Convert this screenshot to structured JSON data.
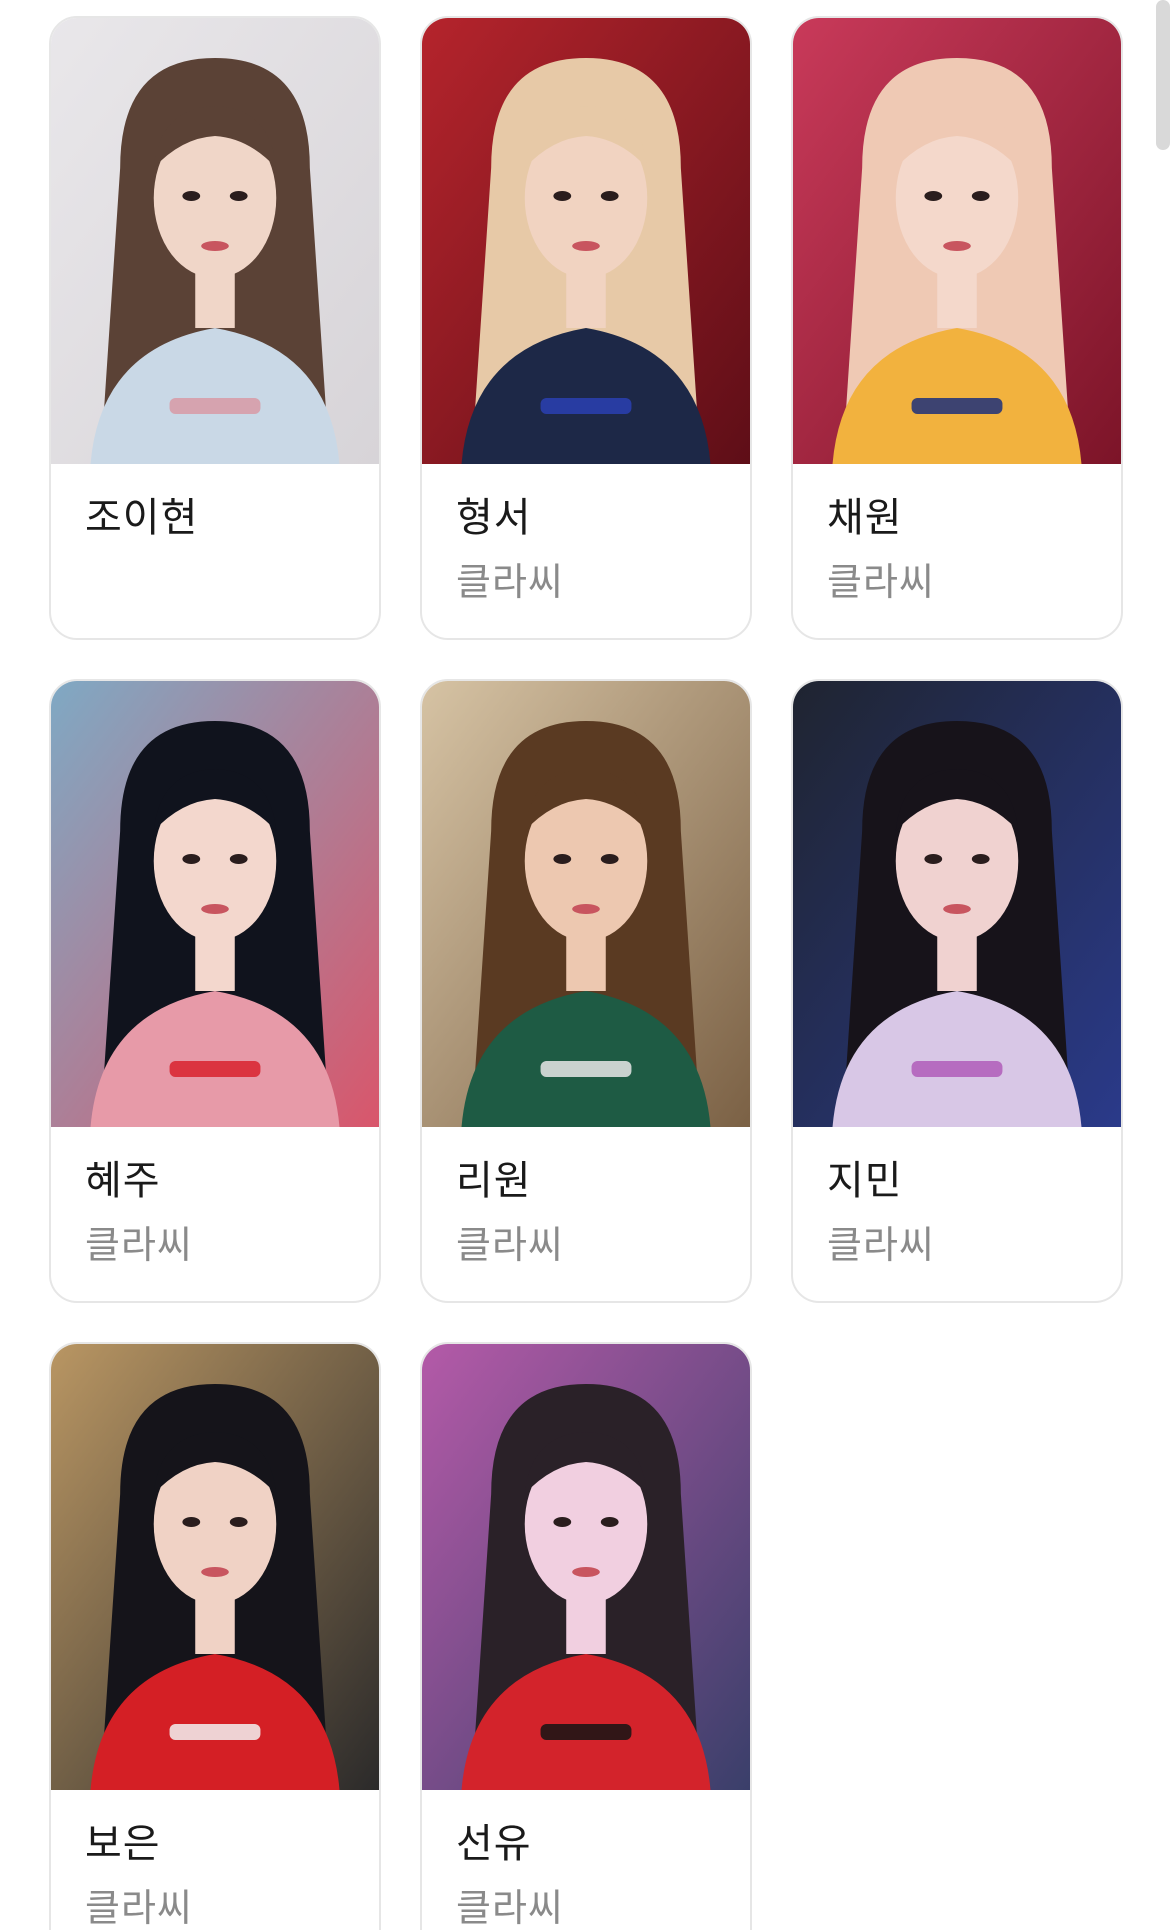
{
  "members": [
    {
      "name": "조이현",
      "group": "",
      "palette": {
        "bg1": "#e9e7ea",
        "bg2": "#d7d4d8",
        "hair": "#5b4236",
        "skin": "#f0d6c8",
        "top": "#c9d8e6",
        "accent": "#d89aa5"
      }
    },
    {
      "name": "형서",
      "group": "클라씨",
      "palette": {
        "bg1": "#b5242c",
        "bg2": "#5e0e17",
        "hair": "#e7c9a7",
        "skin": "#f1d3c1",
        "top": "#1d2847",
        "accent": "#2a3fb3"
      }
    },
    {
      "name": "채원",
      "group": "클라씨",
      "palette": {
        "bg1": "#c93a5a",
        "bg2": "#7c1428",
        "hair": "#efc9b4",
        "skin": "#f4d8cb",
        "top": "#f2b23e",
        "accent": "#1d2f7a"
      }
    },
    {
      "name": "혜주",
      "group": "클라씨",
      "palette": {
        "bg1": "#7fa9c4",
        "bg2": "#d9566b",
        "hair": "#10131d",
        "skin": "#f3d7cd",
        "top": "#e79aa8",
        "accent": "#d8222e"
      }
    },
    {
      "name": "리원",
      "group": "클라씨",
      "palette": {
        "bg1": "#d6c3a4",
        "bg2": "#7b6145",
        "hair": "#5a3a22",
        "skin": "#edc8b0",
        "top": "#1e5b44",
        "accent": "#e7e7e7"
      }
    },
    {
      "name": "지민",
      "group": "클라씨",
      "palette": {
        "bg1": "#1f2430",
        "bg2": "#2a3a8a",
        "hair": "#17131a",
        "skin": "#f0d2d0",
        "top": "#d8c7e6",
        "accent": "#b05cb8"
      }
    },
    {
      "name": "보은",
      "group": "클라씨",
      "palette": {
        "bg1": "#b99663",
        "bg2": "#2b2a2a",
        "hair": "#15141a",
        "skin": "#f0d2c5",
        "top": "#d41f25",
        "accent": "#f2f2f2"
      }
    },
    {
      "name": "선유",
      "group": "클라씨",
      "palette": {
        "bg1": "#b45aa8",
        "bg2": "#3a3f6a",
        "hair": "#2a2128",
        "skin": "#f1cfe0",
        "top": "#d3232b",
        "accent": "#141414"
      }
    }
  ]
}
